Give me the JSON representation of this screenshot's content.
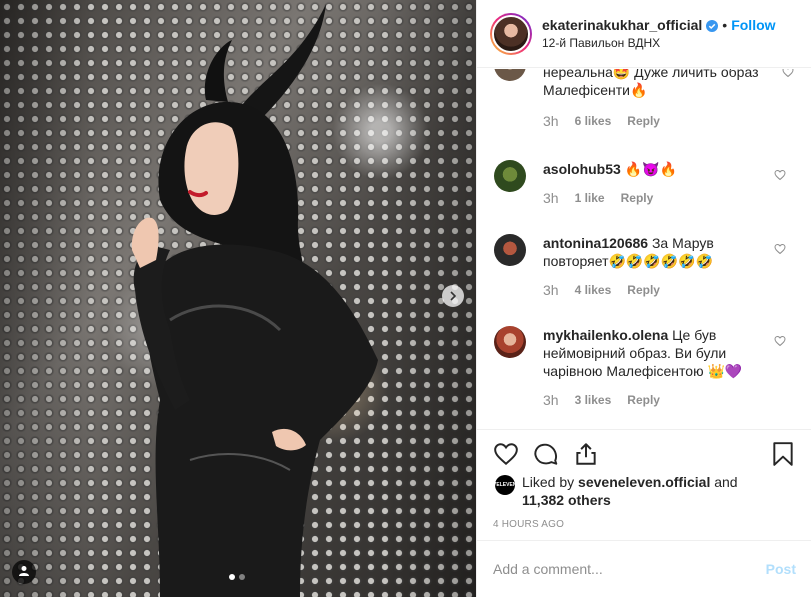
{
  "post": {
    "author": "ekaterinakukhar_official",
    "separator": "•",
    "follow_label": "Follow",
    "location": "12-й Павильон ВДНХ",
    "verified_icon": "verified-badge-icon",
    "accent_color": "#0095f6"
  },
  "photo": {
    "next_icon": "chevron-right-icon",
    "tag_icon": "person-tag-icon",
    "carousel_dots": 2,
    "active_dot": 0
  },
  "comments": [
    {
      "username": "",
      "text": "нереальна🤩 Дуже личить образ Малефісенти🔥",
      "time": "3h",
      "likes": "6 likes",
      "reply": "Reply"
    },
    {
      "username": "asolohub53",
      "text": " 🔥😈🔥",
      "time": "3h",
      "likes": "1 like",
      "reply": "Reply"
    },
    {
      "username": "antonina120686",
      "text": " За Марув повторяет🤣🤣🤣🤣🤣🤣",
      "time": "3h",
      "likes": "4 likes",
      "reply": "Reply"
    },
    {
      "username": "mykhailenko.olena",
      "text": " Це був неймовірний образ. Ви були чарівною Малефісентою 👑💜",
      "time": "3h",
      "likes": "3 likes",
      "reply": "Reply"
    }
  ],
  "actions": {
    "like_icon": "heart-icon",
    "comment_icon": "comment-icon",
    "share_icon": "share-icon",
    "save_icon": "bookmark-icon",
    "liked_by_prefix": "Liked by ",
    "liked_by_user": "seveneleven.official",
    "liked_by_and": " and",
    "others_count": "11,382 others",
    "liked_avatar_text": "7ELEVEN",
    "time_ago": "4 HOURS AGO"
  },
  "add_comment": {
    "placeholder": "Add a comment...",
    "post_label": "Post"
  }
}
